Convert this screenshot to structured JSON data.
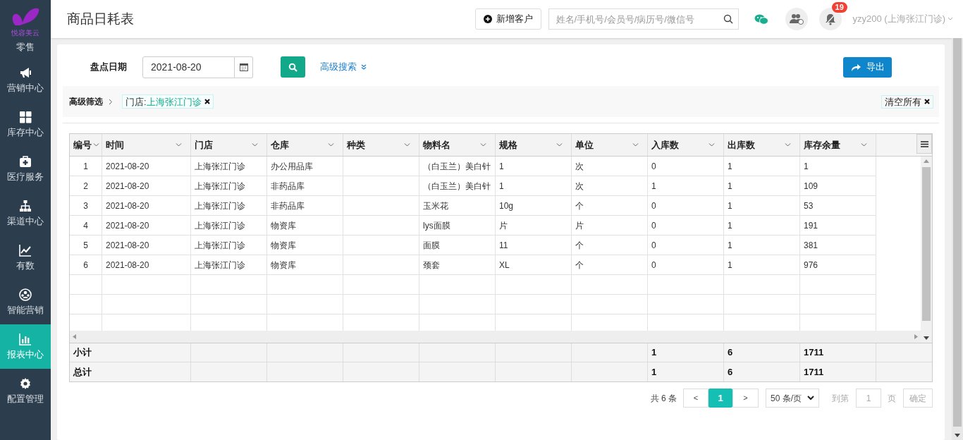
{
  "brand": {
    "name": "悦容美云"
  },
  "sidebar": {
    "items": [
      {
        "label": "零售",
        "selected": false
      },
      {
        "label": "营销中心",
        "selected": false
      },
      {
        "label": "库存中心",
        "selected": false
      },
      {
        "label": "医疗服务",
        "selected": false
      },
      {
        "label": "渠道中心",
        "selected": false
      },
      {
        "label": "有数",
        "selected": false
      },
      {
        "label": "智能营销",
        "selected": false
      },
      {
        "label": "报表中心",
        "selected": true
      },
      {
        "label": "配置管理",
        "selected": false
      }
    ]
  },
  "header": {
    "title": "商品日耗表",
    "add_button": "新增客户",
    "search": {
      "placeholder": "姓名/手机号/会员号/病历号/微信号"
    },
    "notification_count": "19",
    "user": "yzy200 (上海张江门诊)"
  },
  "filters": {
    "date_label": "盘点日期",
    "date_value": "2021-08-20",
    "advanced_search": "高级搜索",
    "export_button": "导出",
    "advanced_filter_label": "高级筛选",
    "tags": [
      {
        "key": "门店:",
        "value": "上海张江门诊"
      }
    ],
    "clear_all": "清空所有"
  },
  "table": {
    "columns": [
      "编号",
      "时间",
      "门店",
      "仓库",
      "种类",
      "物料名",
      "规格",
      "单位",
      "入库数",
      "出库数",
      "库存余量"
    ],
    "rows": [
      [
        "1",
        "2021-08-20",
        "上海张江门诊",
        "办公用品库",
        "",
        "（白玉兰）美白针",
        "1",
        "次",
        "0",
        "1",
        "1"
      ],
      [
        "2",
        "2021-08-20",
        "上海张江门诊",
        "非药品库",
        "",
        "（白玉兰）美白针",
        "1",
        "次",
        "1",
        "1",
        "109"
      ],
      [
        "3",
        "2021-08-20",
        "上海张江门诊",
        "非药品库",
        "",
        "玉米花",
        "10g",
        "个",
        "0",
        "1",
        "53"
      ],
      [
        "4",
        "2021-08-20",
        "上海张江门诊",
        "物资库",
        "",
        "lys面膜",
        "片",
        "片",
        "0",
        "1",
        "191"
      ],
      [
        "5",
        "2021-08-20",
        "上海张江门诊",
        "物资库",
        "",
        "面膜",
        "11",
        "个",
        "0",
        "1",
        "381"
      ],
      [
        "6",
        "2021-08-20",
        "上海张江门诊",
        "物资库",
        "",
        "颈套",
        "XL",
        "个",
        "0",
        "1",
        "976"
      ]
    ],
    "summary_rows": [
      {
        "label": "小计",
        "in": "1",
        "out": "6",
        "stock": "1711"
      },
      {
        "label": "总计",
        "in": "1",
        "out": "6",
        "stock": "1711"
      }
    ]
  },
  "pagination": {
    "total": "共 6 条",
    "prev": "<",
    "pages": [
      {
        "label": "1",
        "selected": true
      }
    ],
    "next": ">",
    "page_size": "50 条/页",
    "goto_label": "到第",
    "goto_value": "1",
    "page_unit": "页",
    "confirm": "确定"
  }
}
